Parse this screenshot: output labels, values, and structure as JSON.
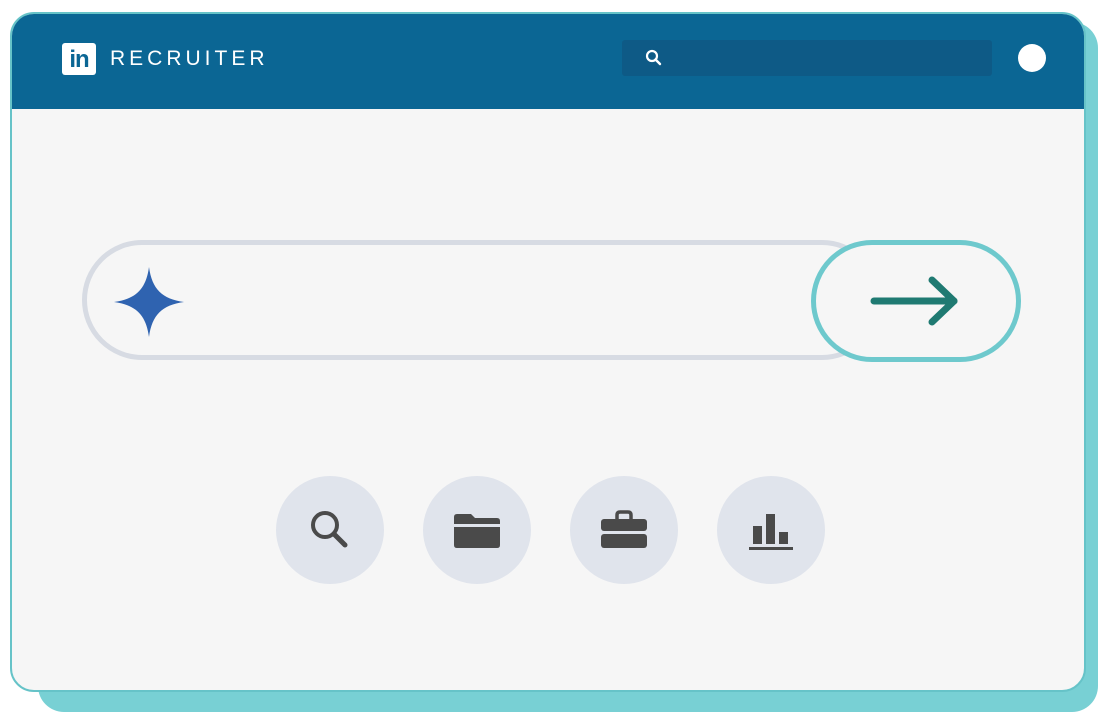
{
  "app": {
    "logo_text": "in",
    "title": "RECRUITER"
  },
  "header": {
    "search_icon": "search-icon",
    "profile_icon": "profile-dot"
  },
  "prompt": {
    "sparkle_icon": "sparkle-icon",
    "submit_icon": "arrow-right-icon"
  },
  "actions": [
    {
      "icon": "search-icon"
    },
    {
      "icon": "folder-icon"
    },
    {
      "icon": "briefcase-icon"
    },
    {
      "icon": "bar-chart-icon"
    }
  ],
  "colors": {
    "brand_blue": "#0b6694",
    "accent_teal": "#6ec9cd",
    "arrow_green": "#1f7a72",
    "sparkle_blue": "#2f63b0",
    "action_bg": "#e0e4ec",
    "icon_dark": "#4a4a4a"
  }
}
